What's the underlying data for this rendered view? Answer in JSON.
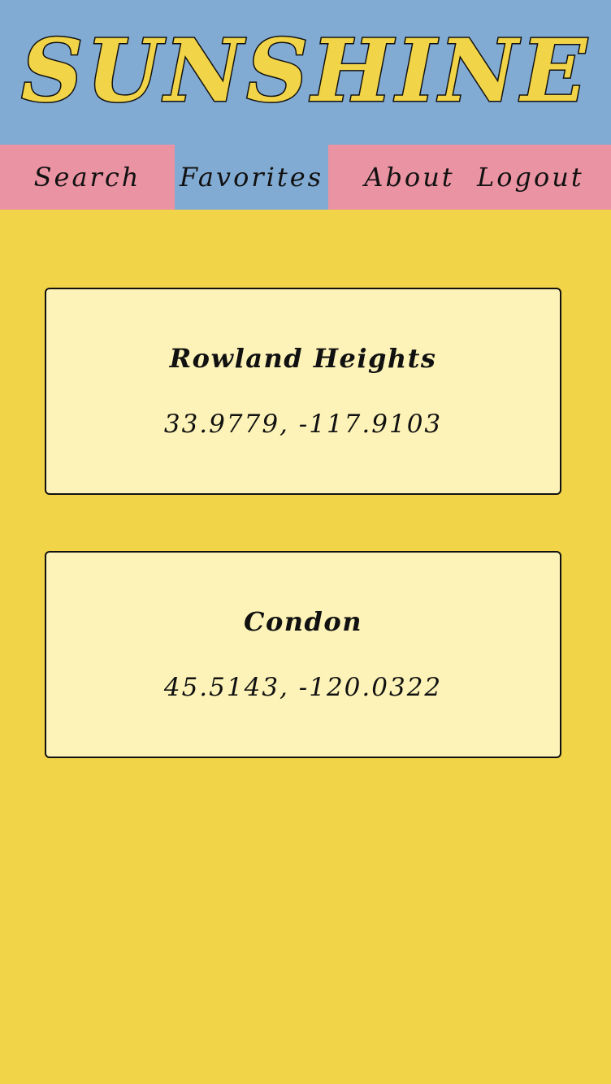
{
  "app": {
    "title": "SUNSHINE",
    "colors": {
      "header_bg": "#82abd3",
      "nav_bg": "#ea93a2",
      "page_bg": "#f1d448",
      "card_bg": "#fdf3b8",
      "logo_fill": "#f1d448"
    }
  },
  "nav": {
    "items": [
      {
        "label": "Search",
        "active": false
      },
      {
        "label": "Favorites",
        "active": true
      },
      {
        "label": "About",
        "active": false
      },
      {
        "label": "Logout",
        "active": false
      }
    ]
  },
  "favorites": [
    {
      "name": "Rowland Heights",
      "coords": "33.9779, -117.9103"
    },
    {
      "name": "Condon",
      "coords": "45.5143, -120.0322"
    }
  ]
}
